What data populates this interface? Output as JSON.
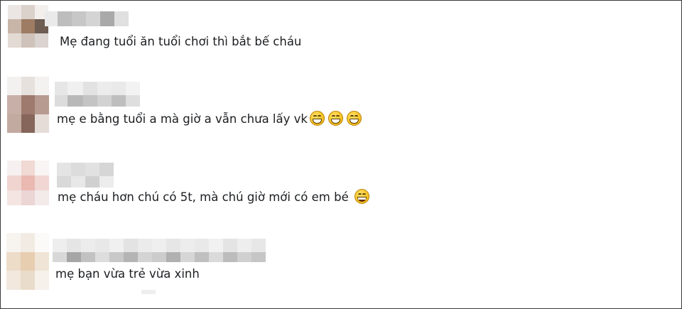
{
  "comments": [
    {
      "text": "Mẹ đang tuổi ăn tuổi chơi thì bắt bế cháu",
      "emojis": []
    },
    {
      "text": "mẹ e bằng tuổi a mà giờ a vẫn chưa lấy vk",
      "emojis": [
        "grin-icon",
        "grin-icon",
        "grin-icon"
      ]
    },
    {
      "text": "mẹ cháu hơn chú có 5t, mà chú giờ mới có em bé",
      "emojis": [
        "laugh-icon"
      ]
    },
    {
      "text": "mẹ bạn vừa trẻ vừa xinh",
      "emojis": []
    }
  ]
}
